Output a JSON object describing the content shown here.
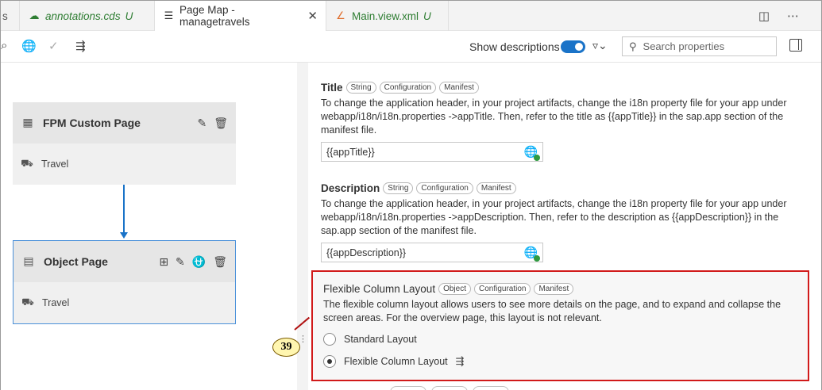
{
  "tabs": [
    {
      "label": "s",
      "icon": "partial-tab"
    },
    {
      "label": "annotations.cds",
      "suffix": "U",
      "icon": "cds-file-icon"
    },
    {
      "label": "Page Map - managetravels",
      "icon": "page-map-icon",
      "close": "✕"
    },
    {
      "label": "Main.view.xml",
      "suffix": "U",
      "icon": "xml-file-icon"
    }
  ],
  "toolbar": {
    "show_descriptions": "Show descriptions",
    "show_descriptions_on": true,
    "search_placeholder": "Search properties"
  },
  "map": {
    "nodes": [
      {
        "title": "FPM Custom Page",
        "entity": "Travel"
      },
      {
        "title": "Object Page",
        "entity": "Travel"
      }
    ]
  },
  "properties": {
    "title": {
      "label": "Title",
      "chips": [
        "String",
        "Configuration",
        "Manifest"
      ],
      "description": "To change the application header, in your project artifacts, change the i18n property file for your app under webapp/i18n/i18n.properties ->appTitle. Then, refer to the title as {{appTitle}} in the sap.app section of the manifest file.",
      "value": "{{appTitle}}"
    },
    "description": {
      "label": "Description",
      "chips": [
        "String",
        "Configuration",
        "Manifest"
      ],
      "description": "To change the application header, in your project artifacts, change the i18n property file for your app under webapp/i18n/i18n.properties ->appDescription. Then, refer to the description as {{appDescription}} in the sap.app section of the manifest file.",
      "value": "{{appDescription}}"
    },
    "fcl": {
      "label": "Flexible Column Layout",
      "chips": [
        "Object",
        "Configuration",
        "Manifest"
      ],
      "description": "The flexible column layout allows users to see more details on the page, and to expand and collapse the screen areas. For the overview page, this layout is not relevant.",
      "options": [
        "Standard Layout",
        "Flexible Column Layout"
      ],
      "selected": "Flexible Column Layout"
    }
  },
  "callout": "39",
  "colors": {
    "accent": "#1a73c8",
    "highlight_border": "#d11a1a",
    "callout_fill": "#fff6b0",
    "modified_file": "#2e7d32"
  }
}
